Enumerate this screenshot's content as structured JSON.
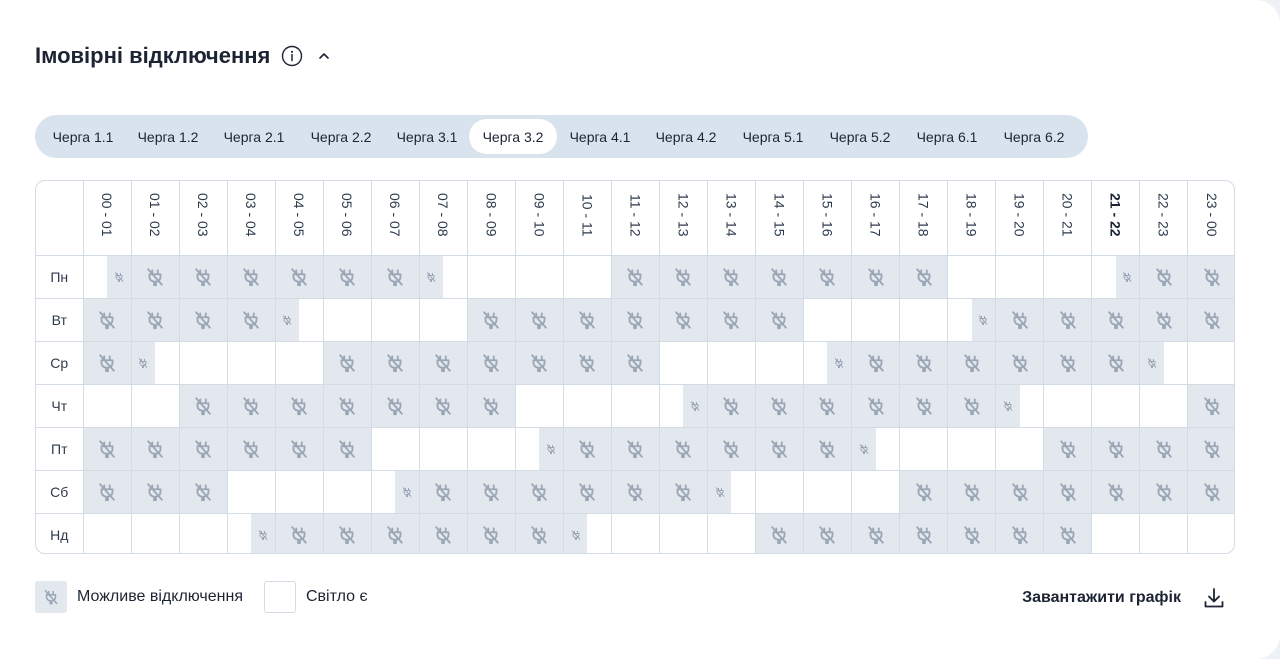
{
  "section": {
    "title": "Імовірні відключення",
    "info_icon": "info-icon",
    "collapse_icon": "chevron-up-icon"
  },
  "tabs": [
    "Черга 1.1",
    "Черга 1.2",
    "Черга 2.1",
    "Черга 2.2",
    "Черга 3.1",
    "Черга 3.2",
    "Черга 4.1",
    "Черга 4.2",
    "Черга 5.1",
    "Черга 5.2",
    "Черга 6.1",
    "Черга 6.2"
  ],
  "active_tab": "Черга 3.2",
  "hours": [
    "00 - 01",
    "01 - 02",
    "02 - 03",
    "03 - 04",
    "04 - 05",
    "05 - 06",
    "06 - 07",
    "07 - 08",
    "08 - 09",
    "09 - 10",
    "10 - 11",
    "11 - 12",
    "12 - 13",
    "13 - 14",
    "14 - 15",
    "15 - 16",
    "16 - 17",
    "17 - 18",
    "18 - 19",
    "19 - 20",
    "20 - 21",
    "21 - 22",
    "22 - 23",
    "23 - 00"
  ],
  "current_hour": "21 - 22",
  "days": [
    {
      "label": "Пн",
      "slots": [
        "r",
        "f",
        "f",
        "f",
        "f",
        "f",
        "f",
        "l",
        "n",
        "n",
        "n",
        "f",
        "f",
        "f",
        "f",
        "f",
        "f",
        "f",
        "n",
        "n",
        "n",
        "r",
        "f",
        "f"
      ]
    },
    {
      "label": "Вт",
      "slots": [
        "f",
        "f",
        "f",
        "f",
        "l",
        "n",
        "n",
        "n",
        "f",
        "f",
        "f",
        "f",
        "f",
        "f",
        "f",
        "n",
        "n",
        "n",
        "r",
        "f",
        "f",
        "f",
        "f",
        "f"
      ]
    },
    {
      "label": "Ср",
      "slots": [
        "f",
        "l",
        "n",
        "n",
        "n",
        "f",
        "f",
        "f",
        "f",
        "f",
        "f",
        "f",
        "n",
        "n",
        "n",
        "r",
        "f",
        "f",
        "f",
        "f",
        "f",
        "f",
        "l",
        "n"
      ]
    },
    {
      "label": "Чт",
      "slots": [
        "n",
        "n",
        "f",
        "f",
        "f",
        "f",
        "f",
        "f",
        "f",
        "n",
        "n",
        "n",
        "r",
        "f",
        "f",
        "f",
        "f",
        "f",
        "f",
        "l",
        "n",
        "n",
        "n",
        "f"
      ]
    },
    {
      "label": "Пт",
      "slots": [
        "f",
        "f",
        "f",
        "f",
        "f",
        "f",
        "n",
        "n",
        "n",
        "r",
        "f",
        "f",
        "f",
        "f",
        "f",
        "f",
        "l",
        "n",
        "n",
        "n",
        "f",
        "f",
        "f",
        "f"
      ]
    },
    {
      "label": "Сб",
      "slots": [
        "f",
        "f",
        "f",
        "n",
        "n",
        "n",
        "r",
        "f",
        "f",
        "f",
        "f",
        "f",
        "f",
        "l",
        "n",
        "n",
        "n",
        "f",
        "f",
        "f",
        "f",
        "f",
        "f",
        "f"
      ]
    },
    {
      "label": "Нд",
      "slots": [
        "n",
        "n",
        "n",
        "r",
        "f",
        "f",
        "f",
        "f",
        "f",
        "f",
        "l",
        "n",
        "n",
        "n",
        "f",
        "f",
        "f",
        "f",
        "f",
        "f",
        "f",
        "n",
        "n",
        "n"
      ]
    }
  ],
  "legend": {
    "outage_label": "Можливе відключення",
    "power_label": "Світло є",
    "outage_icon": "power-off-icon"
  },
  "download": {
    "label": "Завантажити графік",
    "icon": "download-icon"
  },
  "colors": {
    "outage_fill": "#e3e8ee",
    "outage_icon": "#9aa6b5",
    "tabs_bg": "#d9e3ee",
    "border": "#d3dbe5",
    "text": "#1c2433"
  }
}
